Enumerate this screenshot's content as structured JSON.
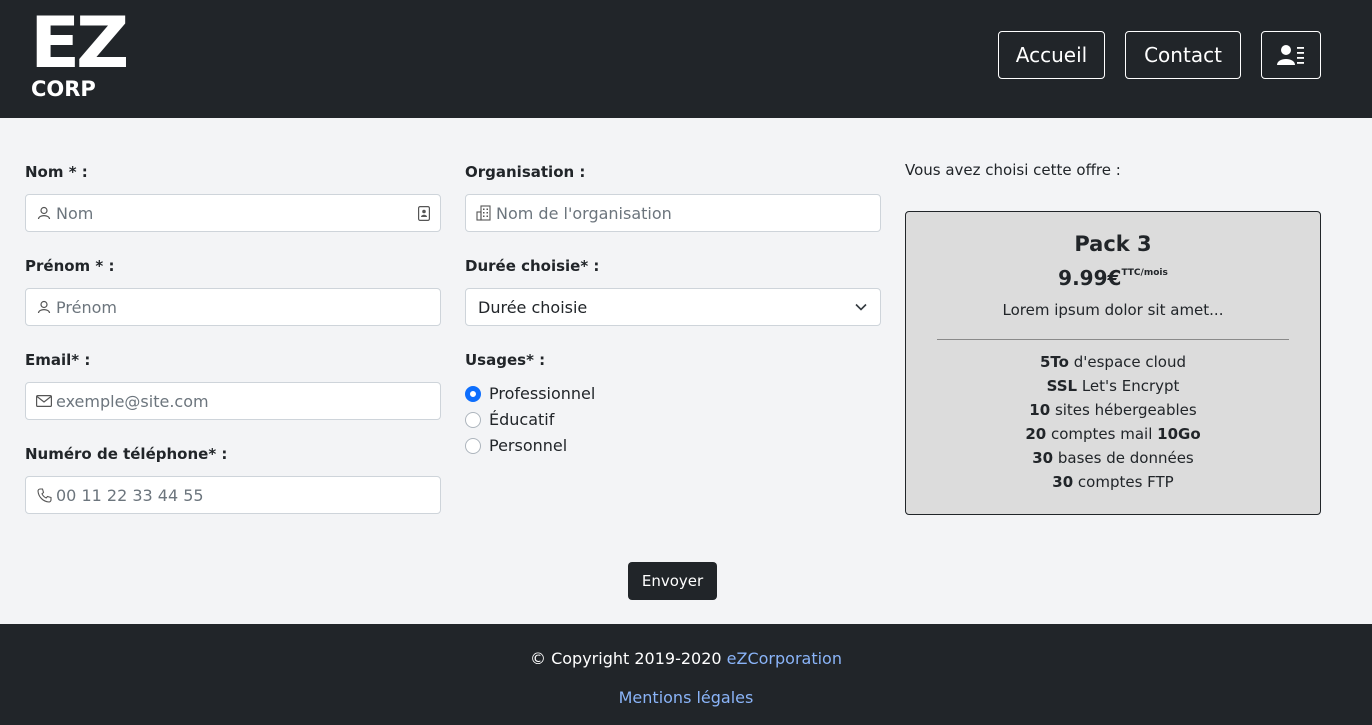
{
  "header": {
    "logo_top": "EZ",
    "logo_bottom": "CORP",
    "nav": {
      "home": "Accueil",
      "contact": "Contact"
    }
  },
  "form": {
    "nom": {
      "label": "Nom * :",
      "placeholder": "Nom"
    },
    "prenom": {
      "label": "Prénom * :",
      "placeholder": "Prénom"
    },
    "email": {
      "label": "Email* :",
      "placeholder": "exemple@site.com"
    },
    "telephone": {
      "label": "Numéro de téléphone* :",
      "placeholder": "00 11 22 33 44 55"
    },
    "organisation": {
      "label": "Organisation :",
      "placeholder": "Nom de l'organisation"
    },
    "duree": {
      "label": "Durée choisie* :",
      "value": "Durée choisie"
    },
    "usages": {
      "label": "Usages* :",
      "options": [
        "Professionnel",
        "Éducatif",
        "Personnel"
      ],
      "selected": "Professionnel"
    },
    "submit": "Envoyer"
  },
  "offer": {
    "intro": "Vous avez choisi cette offre :",
    "name": "Pack 3",
    "price": "9.99€",
    "price_unit": "TTC/mois",
    "description": "Lorem ipsum dolor sit amet...",
    "features": [
      {
        "bold": "5To",
        "text": " d'espace cloud"
      },
      {
        "bold": "SSL",
        "text": " Let's Encrypt"
      },
      {
        "bold": "10",
        "text": " sites hébergeables"
      },
      {
        "bold": "20",
        "text": " comptes mail ",
        "bold2": "10Go"
      },
      {
        "bold": "30",
        "text": " bases de données"
      },
      {
        "bold": "30",
        "text": " comptes FTP"
      }
    ]
  },
  "footer": {
    "copyright": "© Copyright 2019-2020 ",
    "company_link": "eZCorporation",
    "legal_link": "Mentions légales"
  },
  "colors": {
    "dark": "#212529",
    "accent": "#0d6efd",
    "link": "#8ab4f8",
    "card_bg": "#dcdcdc"
  }
}
